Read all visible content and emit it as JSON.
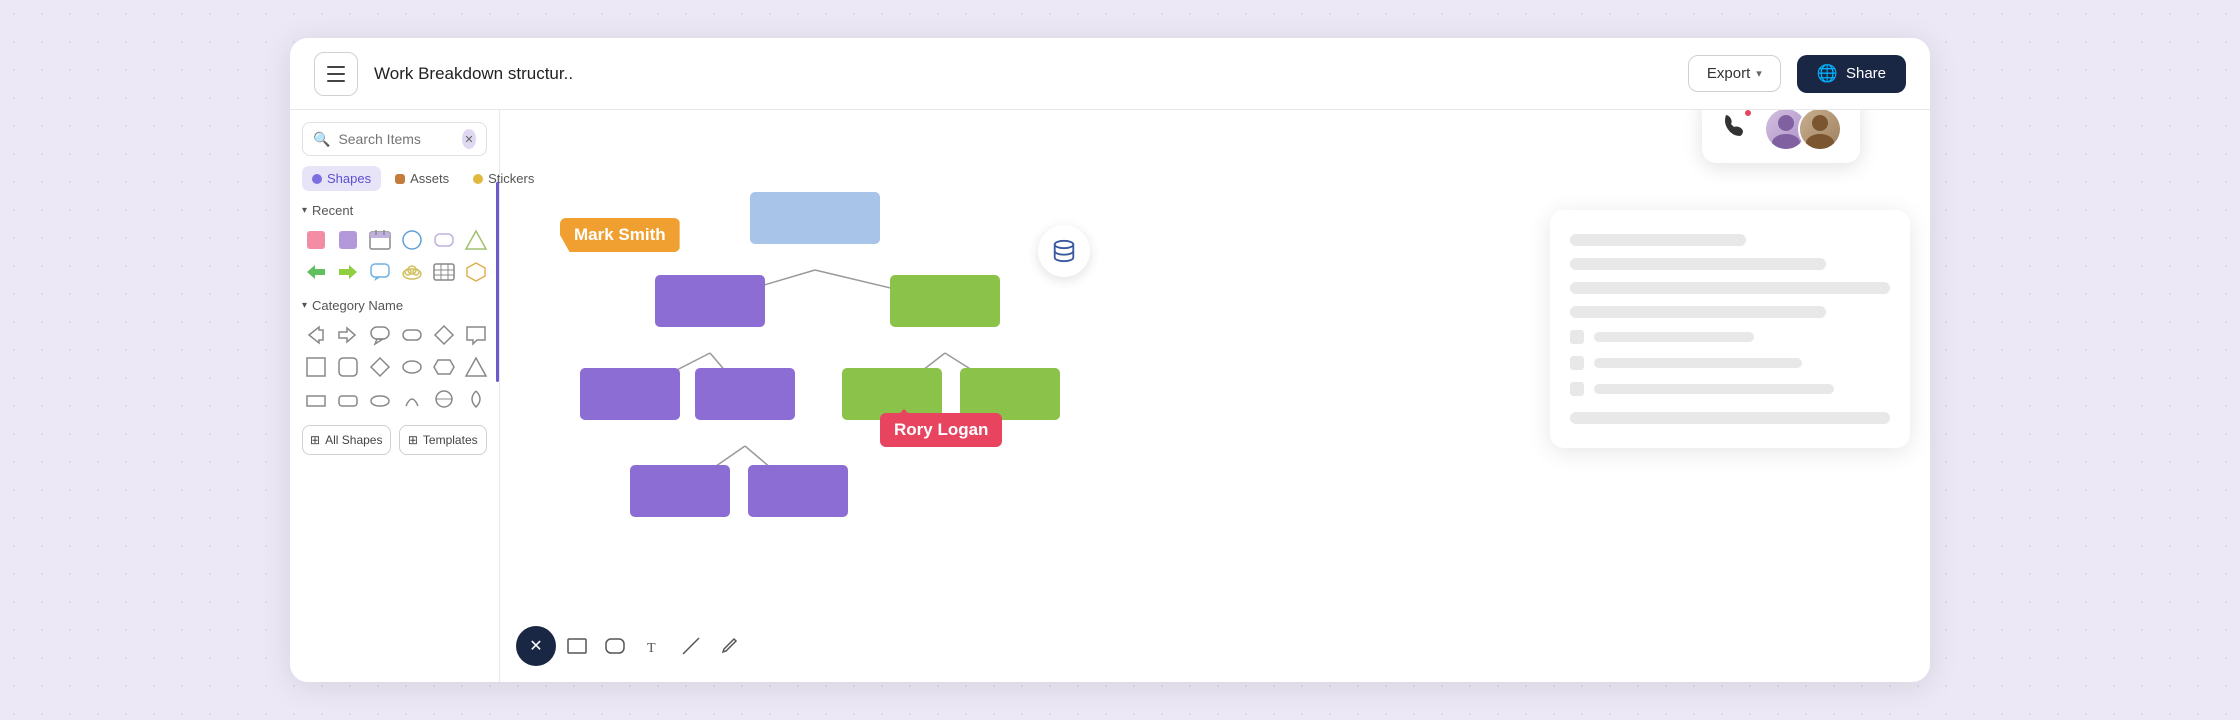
{
  "header": {
    "hamburger_label": "menu",
    "doc_title": "Work Breakdown structur..",
    "export_label": "Export",
    "share_label": "Share",
    "globe_icon": "🌐"
  },
  "left_panel": {
    "search_placeholder": "Search Items",
    "tabs": [
      {
        "id": "shapes",
        "label": "Shapes",
        "active": true
      },
      {
        "id": "assets",
        "label": "Assets",
        "active": false
      },
      {
        "id": "stickers",
        "label": "Stickers",
        "active": false
      }
    ],
    "recent_label": "Recent",
    "category_label": "Category Name",
    "all_shapes_label": "All Shapes",
    "templates_label": "Templates"
  },
  "diagram": {
    "mark_smith_label": "Mark Smith",
    "rory_logan_label": "Rory Logan"
  },
  "call_card": {
    "phone_icon": "📞"
  },
  "bottom_toolbar": {
    "close_icon": "✕",
    "rect_icon": "▭",
    "rounded_icon": "▢",
    "text_icon": "T",
    "line_icon": "╲",
    "pen_icon": "✏"
  },
  "colors": {
    "accent_purple": "#6b5bcf",
    "node_purple": "#8b6dd4",
    "node_blue": "#a8c4e8",
    "node_green": "#8bc34a",
    "orange_label": "#f0a030",
    "red_label": "#e84460",
    "dark_navy": "#1a2744"
  }
}
